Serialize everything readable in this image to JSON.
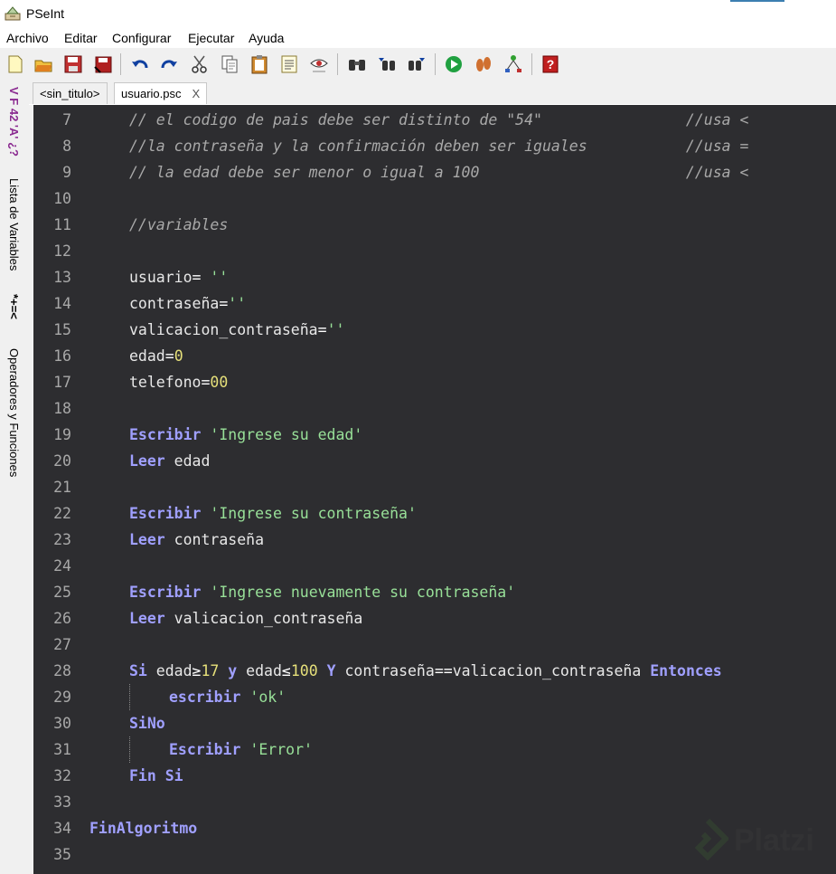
{
  "window": {
    "title": "PSeInt"
  },
  "menu": [
    "Archivo",
    "Editar",
    "Configurar",
    "Ejecutar",
    "Ayuda"
  ],
  "toolbar_icons": [
    "new-file-icon",
    "open-file-icon",
    "save-icon",
    "save-as-icon",
    "undo-icon",
    "redo-icon",
    "cut-icon",
    "copy-icon",
    "paste-icon",
    "list-icon",
    "eye-icon",
    "search-icon",
    "find-prev-icon",
    "find-next-icon",
    "run-icon",
    "step-icon",
    "diagram-icon",
    "help-icon"
  ],
  "side_panel": {
    "variables_symbols": "V F 42 'A' ¿?",
    "variables_label": "Lista de Variables",
    "operators_symbols": "*+=<",
    "operators_label": "Operadores y Funciones"
  },
  "tabs": [
    {
      "label": "<sin_titulo>",
      "active": false
    },
    {
      "label": "usuario.psc",
      "active": true,
      "close": "X"
    }
  ],
  "code_lines": [
    {
      "n": "7",
      "indent": 1,
      "tokens": [
        [
          "cm",
          "// el codigo de pais debe ser distinto de \"54\"                //usa <"
        ]
      ]
    },
    {
      "n": "8",
      "indent": 1,
      "tokens": [
        [
          "cm",
          "//la contraseña y la confirmación deben ser iguales           //usa ="
        ]
      ]
    },
    {
      "n": "9",
      "indent": 1,
      "tokens": [
        [
          "cm",
          "// la edad debe ser menor o igual a 100                       //usa <"
        ]
      ]
    },
    {
      "n": "10",
      "indent": 0,
      "tokens": []
    },
    {
      "n": "11",
      "indent": 1,
      "tokens": [
        [
          "cm",
          "//variables"
        ]
      ]
    },
    {
      "n": "12",
      "indent": 0,
      "tokens": []
    },
    {
      "n": "13",
      "indent": 1,
      "tokens": [
        [
          "var",
          "usuario"
        ],
        [
          "op",
          "= "
        ],
        [
          "str",
          "''"
        ]
      ]
    },
    {
      "n": "14",
      "indent": 1,
      "tokens": [
        [
          "var",
          "contraseña"
        ],
        [
          "op",
          "="
        ],
        [
          "str",
          "''"
        ]
      ]
    },
    {
      "n": "15",
      "indent": 1,
      "tokens": [
        [
          "var",
          "valicacion_contraseña"
        ],
        [
          "op",
          "="
        ],
        [
          "str",
          "''"
        ]
      ]
    },
    {
      "n": "16",
      "indent": 1,
      "tokens": [
        [
          "var",
          "edad"
        ],
        [
          "op",
          "="
        ],
        [
          "num",
          "0"
        ]
      ]
    },
    {
      "n": "17",
      "indent": 1,
      "tokens": [
        [
          "var",
          "telefono"
        ],
        [
          "op",
          "="
        ],
        [
          "num",
          "00"
        ]
      ]
    },
    {
      "n": "18",
      "indent": 0,
      "tokens": []
    },
    {
      "n": "19",
      "indent": 1,
      "tokens": [
        [
          "kw",
          "Escribir"
        ],
        [
          "var",
          " "
        ],
        [
          "str",
          "'Ingrese su edad'"
        ]
      ]
    },
    {
      "n": "20",
      "indent": 1,
      "tokens": [
        [
          "kw",
          "Leer"
        ],
        [
          "var",
          " edad"
        ]
      ]
    },
    {
      "n": "21",
      "indent": 0,
      "tokens": []
    },
    {
      "n": "22",
      "indent": 1,
      "tokens": [
        [
          "kw",
          "Escribir"
        ],
        [
          "var",
          " "
        ],
        [
          "str",
          "'Ingrese su contraseña'"
        ]
      ]
    },
    {
      "n": "23",
      "indent": 1,
      "tokens": [
        [
          "kw",
          "Leer"
        ],
        [
          "var",
          " contraseña"
        ]
      ]
    },
    {
      "n": "24",
      "indent": 0,
      "tokens": []
    },
    {
      "n": "25",
      "indent": 1,
      "tokens": [
        [
          "kw",
          "Escribir"
        ],
        [
          "var",
          " "
        ],
        [
          "str",
          "'Ingrese nuevamente su contraseña'"
        ]
      ]
    },
    {
      "n": "26",
      "indent": 1,
      "tokens": [
        [
          "kw",
          "Leer"
        ],
        [
          "var",
          " valicacion_contraseña"
        ]
      ]
    },
    {
      "n": "27",
      "indent": 0,
      "tokens": []
    },
    {
      "n": "28",
      "indent": 1,
      "tokens": [
        [
          "kw",
          "Si"
        ],
        [
          "var",
          " edad"
        ],
        [
          "op",
          "≥"
        ],
        [
          "num",
          "17"
        ],
        [
          "var",
          " "
        ],
        [
          "kw",
          "y"
        ],
        [
          "var",
          " edad"
        ],
        [
          "op",
          "≤"
        ],
        [
          "num",
          "100"
        ],
        [
          "var",
          " "
        ],
        [
          "kw",
          "Y"
        ],
        [
          "var",
          " contraseña"
        ],
        [
          "op",
          "=="
        ],
        [
          "var",
          "valicacion_contraseña "
        ],
        [
          "kw",
          "Entonces"
        ]
      ]
    },
    {
      "n": "29",
      "indent": 2,
      "tokens": [
        [
          "kw",
          "escribir"
        ],
        [
          "var",
          " "
        ],
        [
          "str",
          "'ok'"
        ]
      ]
    },
    {
      "n": "30",
      "indent": 1,
      "tokens": [
        [
          "kw",
          "SiNo"
        ]
      ]
    },
    {
      "n": "31",
      "indent": 2,
      "tokens": [
        [
          "kw",
          "Escribir"
        ],
        [
          "var",
          " "
        ],
        [
          "str",
          "'Error'"
        ]
      ]
    },
    {
      "n": "32",
      "indent": 1,
      "tokens": [
        [
          "kw",
          "Fin Si"
        ]
      ]
    },
    {
      "n": "33",
      "indent": 0,
      "tokens": []
    },
    {
      "n": "34",
      "indent": 0,
      "tokens": [
        [
          "kw",
          "FinAlgoritmo"
        ]
      ]
    },
    {
      "n": "35",
      "indent": 0,
      "tokens": []
    }
  ],
  "watermark": "Platzi",
  "colors": {
    "editor_bg": "#2d2d30",
    "keyword": "#a0a0ff",
    "string": "#98e098",
    "number": "#e6e07a",
    "comment": "#a9a9a9"
  }
}
